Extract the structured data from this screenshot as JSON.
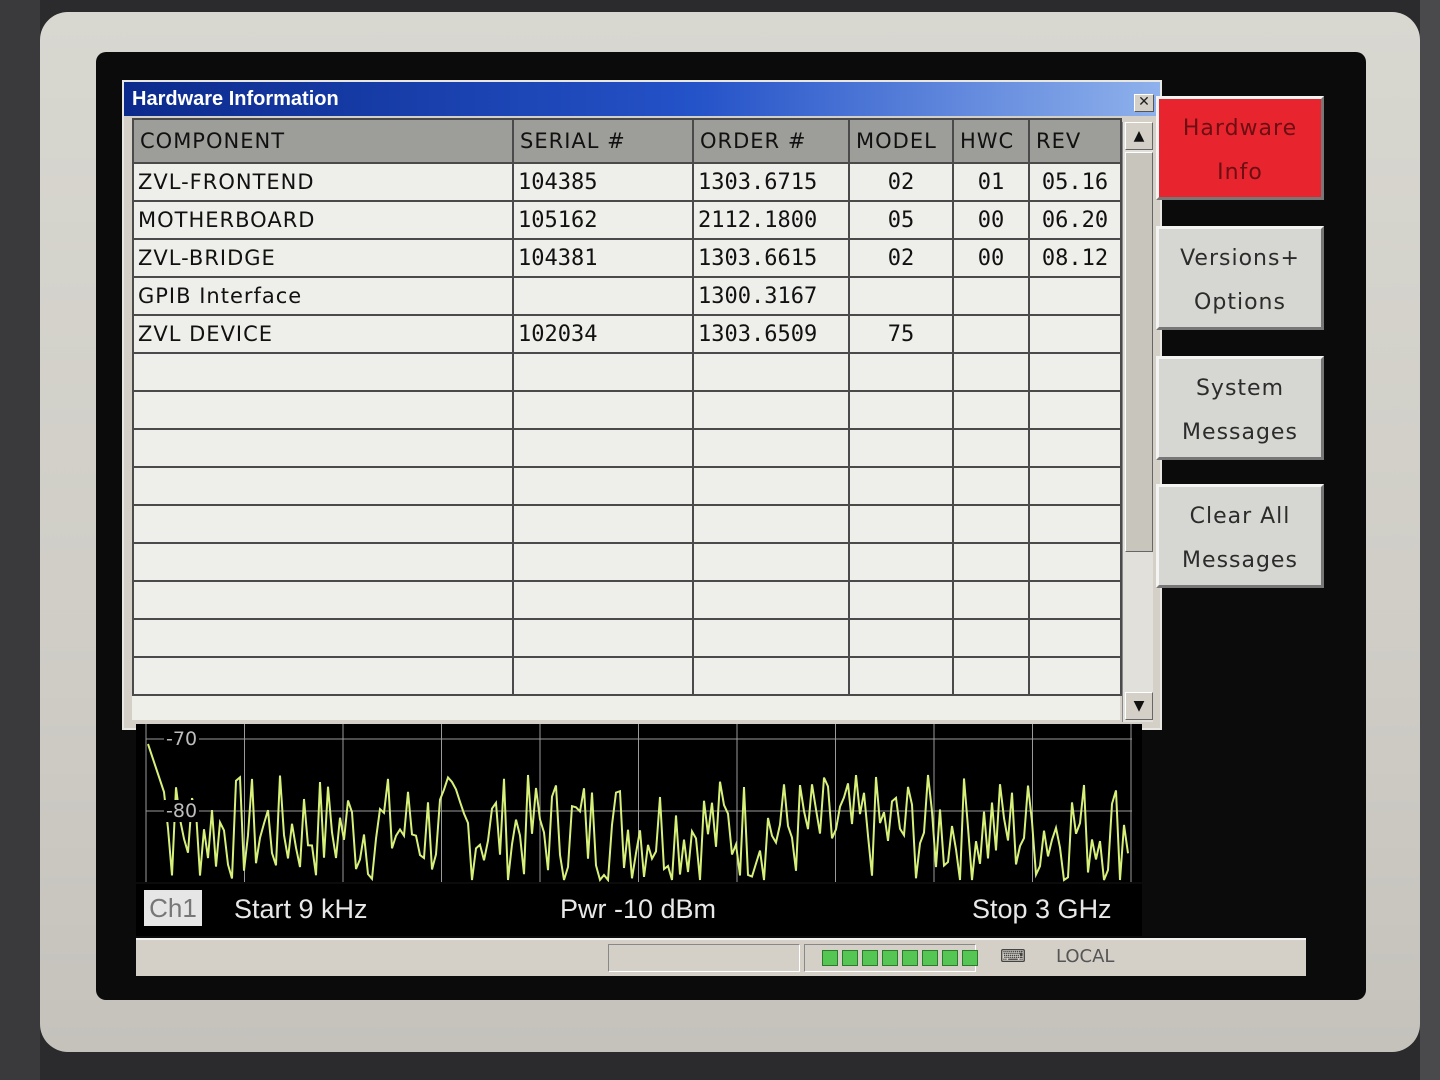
{
  "dialog": {
    "title": "Hardware Information",
    "close_glyph": "✕"
  },
  "table": {
    "headers": [
      "COMPONENT",
      "SERIAL #",
      "ORDER #",
      "MODEL",
      "HWC",
      "REV"
    ],
    "rows": [
      [
        "ZVL-FRONTEND",
        "104385",
        "1303.6715",
        "02",
        "01",
        "05.16"
      ],
      [
        "MOTHERBOARD",
        "105162",
        "2112.1800",
        "05",
        "00",
        "06.20"
      ],
      [
        "ZVL-BRIDGE",
        "104381",
        "1303.6615",
        "02",
        "00",
        "08.12"
      ],
      [
        "GPIB Interface",
        "",
        "1300.3167",
        "",
        "",
        ""
      ],
      [
        "ZVL DEVICE",
        "102034",
        "1303.6509",
        "75",
        "",
        ""
      ]
    ]
  },
  "softkeys": [
    {
      "line1": "Hardware",
      "line2": "Info",
      "active": true
    },
    {
      "line1": "Versions+",
      "line2": "Options",
      "active": false
    },
    {
      "line1": "System",
      "line2": "Messages",
      "active": false
    },
    {
      "line1": "Clear All",
      "line2": "Messages",
      "active": false
    }
  ],
  "trace": {
    "y_labels": [
      "-70",
      "-80"
    ],
    "trace_color": "#d6f07a"
  },
  "infobar": {
    "channel": "Ch1",
    "start": "Start  9 kHz",
    "power": "Pwr  -10 dBm",
    "stop": "Stop  3 GHz"
  },
  "statusbar": {
    "mode": "LOCAL"
  },
  "colors": {
    "title_bar": "#0c2a8c",
    "active_softkey": "#e8242e",
    "trace": "#d6f07a"
  }
}
